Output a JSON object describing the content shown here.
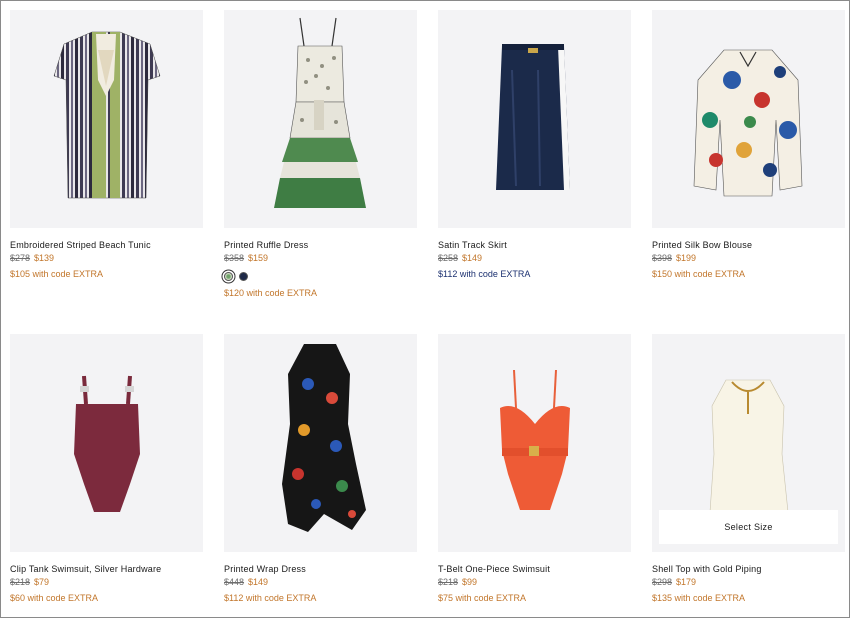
{
  "products": [
    {
      "name": "Embroidered Striped Beach Tunic",
      "old_price": "$278",
      "new_price": "$139",
      "promo": "$105 with code EXTRA"
    },
    {
      "name": "Printed Ruffle Dress",
      "old_price": "$358",
      "new_price": "$159",
      "promo": "$120 with code EXTRA",
      "swatches": [
        "green print",
        "navy"
      ]
    },
    {
      "name": "Satin Track Skirt",
      "old_price": "$258",
      "new_price": "$149",
      "promo": "$112 with code EXTRA"
    },
    {
      "name": "Printed Silk Bow Blouse",
      "old_price": "$398",
      "new_price": "$199",
      "promo": "$150 with code EXTRA"
    },
    {
      "name": "Clip Tank Swimsuit, Silver Hardware",
      "old_price": "$218",
      "new_price": "$79",
      "promo": "$60 with code EXTRA"
    },
    {
      "name": "Printed Wrap Dress",
      "old_price": "$448",
      "new_price": "$149",
      "promo": "$112 with code EXTRA"
    },
    {
      "name": "T-Belt One-Piece Swimsuit",
      "old_price": "$218",
      "new_price": "$99",
      "promo": "$75 with code EXTRA"
    },
    {
      "name": "Shell Top with Gold Piping",
      "old_price": "$298",
      "new_price": "$179",
      "promo": "$135 with code EXTRA",
      "hover_button": "Select Size"
    }
  ],
  "colors": {
    "sale_price": "#c2762b",
    "promo_navy": "#1c3170",
    "image_bg": "#f3f3f5"
  }
}
